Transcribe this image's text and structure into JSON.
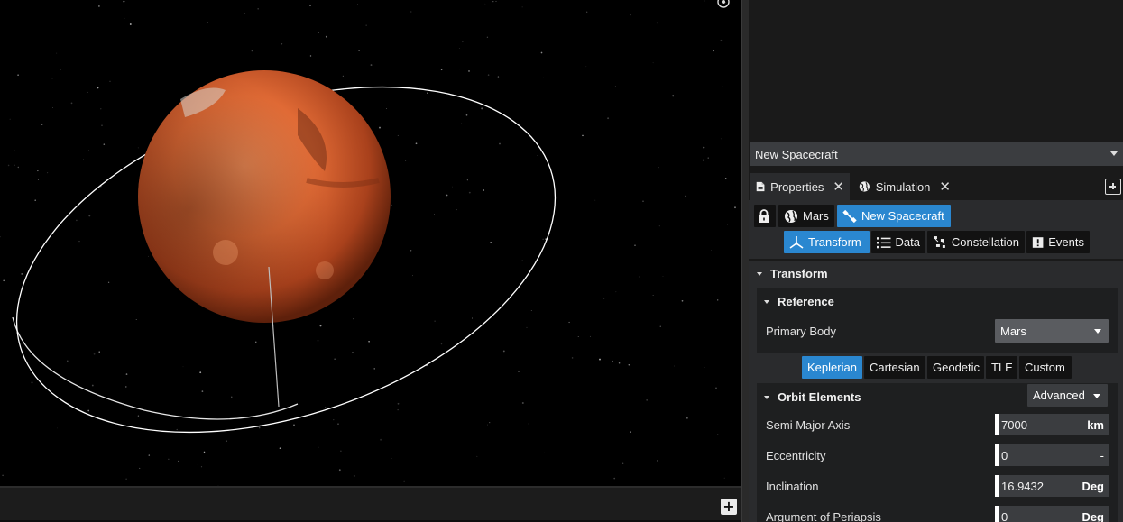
{
  "object_selector": {
    "value": "New Spacecraft"
  },
  "tabs": [
    {
      "label": "Properties",
      "icon": "document-icon",
      "active": true
    },
    {
      "label": "Simulation",
      "icon": "globe-icon",
      "active": false
    }
  ],
  "breadcrumb": {
    "body": "Mars",
    "spacecraft": "New Spacecraft"
  },
  "sub_tabs": [
    {
      "label": "Transform",
      "icon": "axes-icon",
      "selected": true
    },
    {
      "label": "Data",
      "icon": "list-icon",
      "selected": false
    },
    {
      "label": "Constellation",
      "icon": "satellites-icon",
      "selected": false
    },
    {
      "label": "Events",
      "icon": "alert-icon",
      "selected": false
    }
  ],
  "transform": {
    "section_title": "Transform",
    "reference": {
      "title": "Reference",
      "primary_body_label": "Primary Body",
      "primary_body_value": "Mars"
    },
    "state_types": [
      "Keplerian",
      "Cartesian",
      "Geodetic",
      "TLE",
      "Custom"
    ],
    "selected_state_type": "Keplerian",
    "orbit_elements": {
      "title": "Orbit Elements",
      "mode": "Advanced",
      "rows": [
        {
          "label": "Semi Major Axis",
          "value": "7000",
          "unit": "km"
        },
        {
          "label": "Eccentricity",
          "value": "0",
          "unit": "-"
        },
        {
          "label": "Inclination",
          "value": "16.9432",
          "unit": "Deg"
        },
        {
          "label": "Argument of Periapsis",
          "value": "0",
          "unit": "Deg"
        }
      ]
    }
  },
  "colors": {
    "accent": "#2a87d0",
    "planet": "#d0582a",
    "orbit": "#ffffff"
  }
}
